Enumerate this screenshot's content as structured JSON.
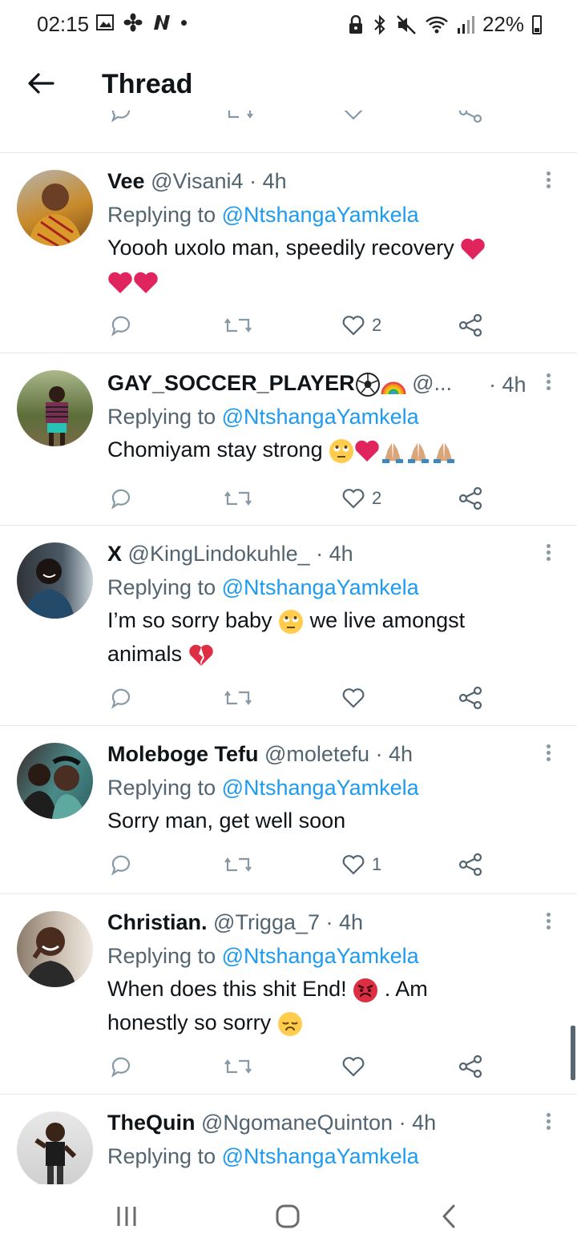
{
  "status_bar": {
    "time": "02:15",
    "battery": "22%",
    "left_icons": [
      "image-icon",
      "fan-icon",
      "n-logo-icon",
      "dot-icon"
    ],
    "right_icons": [
      "lock-icon",
      "bluetooth-icon",
      "mute-icon",
      "wifi-icon",
      "signal-icon",
      "battery-icon"
    ]
  },
  "header": {
    "title": "Thread",
    "back_icon": "back-arrow-icon"
  },
  "tweets": [
    {
      "name": "Vee",
      "handle": "@Visani4",
      "time": "· 4h",
      "replying_prefix": "Replying to ",
      "replying_to": "@NtshangaYamkela",
      "text": "Yoooh uxolo man, speedily recovery",
      "likes": "2",
      "avatar_color": "#c98a2a"
    },
    {
      "name": "GAY_SOCCER_PLAYER",
      "handle": "@...",
      "time": "· 4h",
      "replying_prefix": "Replying to ",
      "replying_to": "@NtshangaYamkela",
      "text": "Chomiyam stay strong",
      "likes": "2",
      "avatar_color": "#5c6e3a"
    },
    {
      "name": "X",
      "handle": "@KingLindokuhle_",
      "time": "· 4h",
      "replying_prefix": "Replying to ",
      "replying_to": "@NtshangaYamkela",
      "text_line1": "I’m so sorry baby",
      "text_line1b": "we live amongst",
      "text_line2": "animals",
      "likes": "",
      "avatar_color": "#3b3f44"
    },
    {
      "name": "Moleboge Tefu",
      "handle": "@moletefu",
      "time": "· 4h",
      "replying_prefix": "Replying to ",
      "replying_to": "@NtshangaYamkela",
      "text": "Sorry man, get well soon",
      "likes": "1",
      "avatar_color": "#4a8b8a"
    },
    {
      "name": "Christian.",
      "handle": "@Trigga_7",
      "time": "· 4h",
      "replying_prefix": "Replying to ",
      "replying_to": "@NtshangaYamkela",
      "text_line1": "When does this shit End!",
      "text_line1b": ". Am",
      "text_line2": "honestly so sorry",
      "likes": "",
      "avatar_color": "#8a6f5a"
    },
    {
      "name": "TheQuin",
      "handle": "@NgomaneQuinton",
      "time": "· 4h",
      "replying_prefix": "Replying to ",
      "replying_to": "@NtshangaYamkela",
      "avatar_color": "#d9d9d9"
    }
  ],
  "colors": {
    "mention": "#1d9bf0",
    "secondary": "#536471",
    "heart": "#e0245e"
  },
  "nav": {
    "icons": [
      "recent-apps-icon",
      "home-icon",
      "back-icon"
    ]
  }
}
